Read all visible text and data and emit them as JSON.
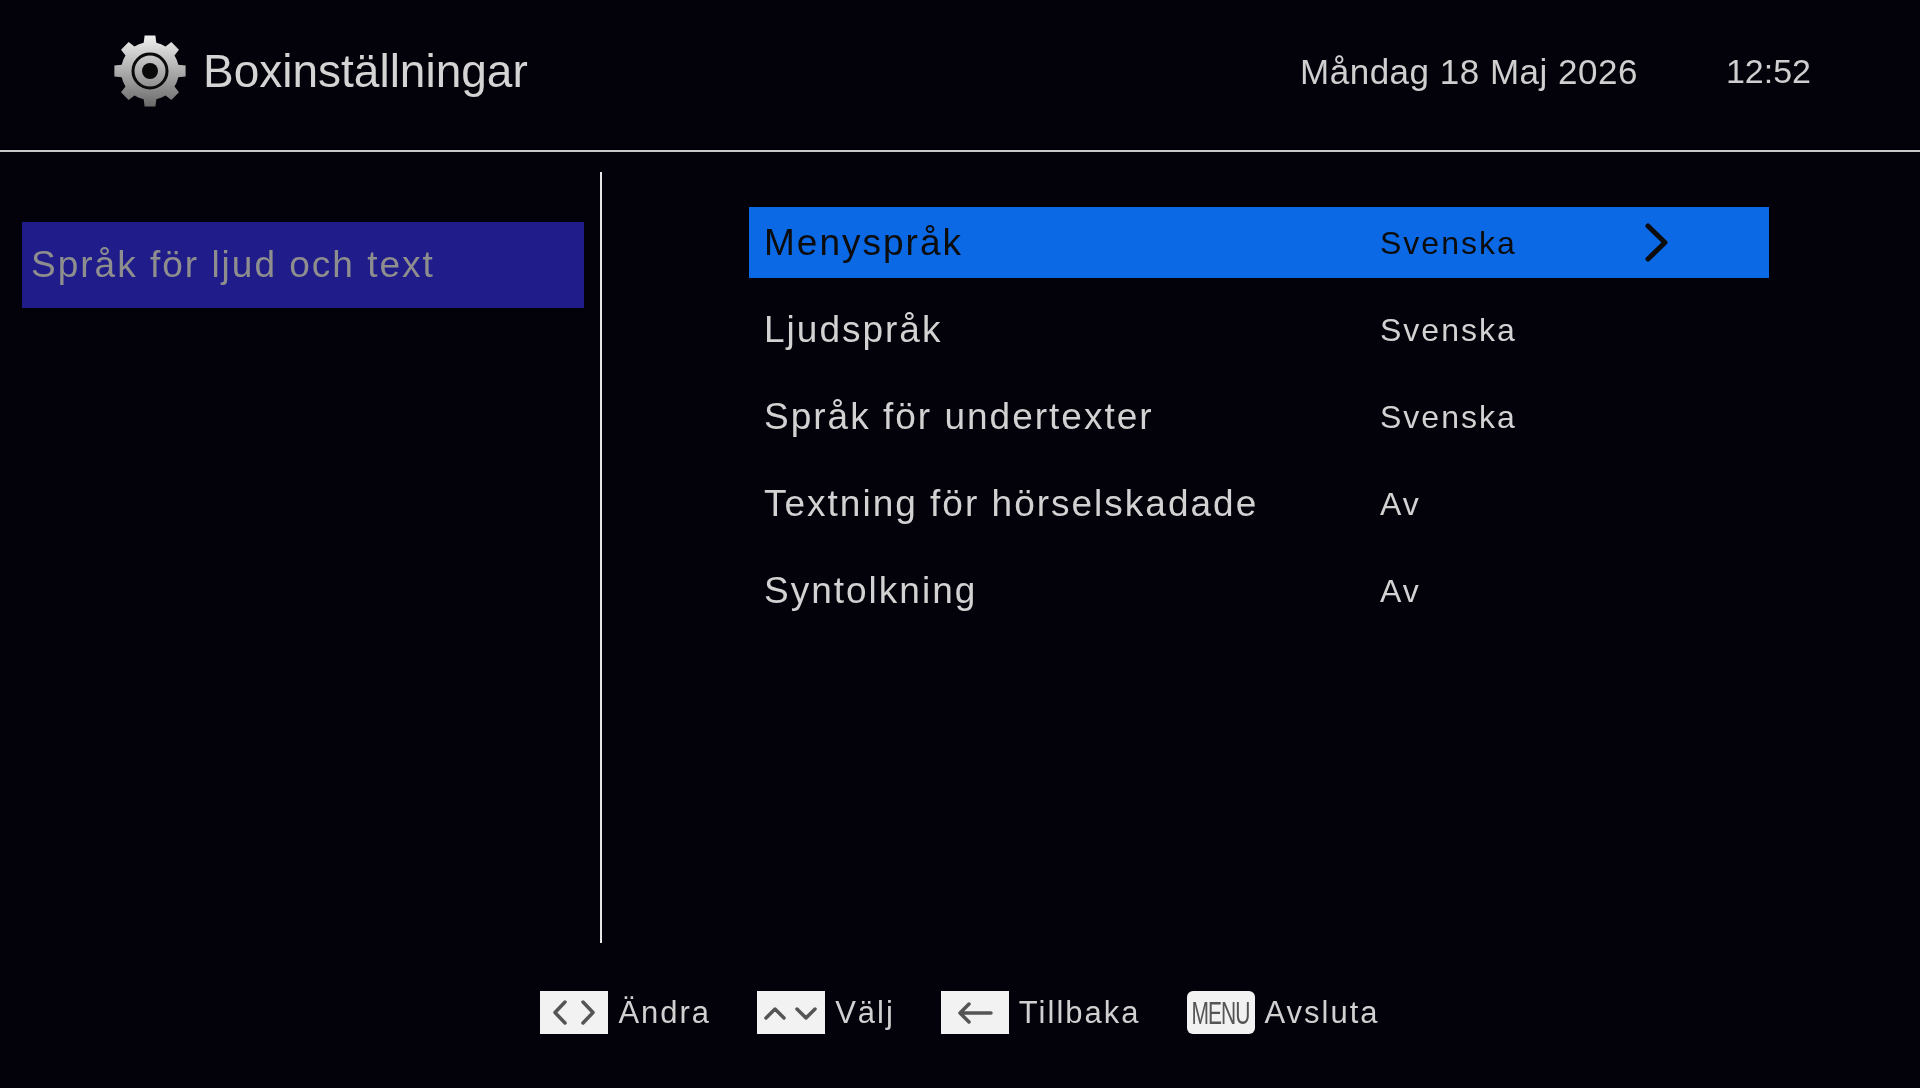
{
  "header": {
    "title": "Boxinställningar",
    "date": "Måndag 18 Maj 2026",
    "time": "12:52"
  },
  "sidebar": {
    "items": [
      {
        "label": "Språk för ljud och text",
        "selected": true
      }
    ]
  },
  "settings": [
    {
      "label": "Menyspråk",
      "value": "Svenska",
      "selected": true
    },
    {
      "label": "Ljudspråk",
      "value": "Svenska",
      "selected": false
    },
    {
      "label": "Språk för undertexter",
      "value": "Svenska",
      "selected": false
    },
    {
      "label": "Textning för hörselskadade",
      "value": "Av",
      "selected": false
    },
    {
      "label": "Syntolkning",
      "value": "Av",
      "selected": false
    }
  ],
  "footer": {
    "hints": [
      {
        "kind": "left_right",
        "label": "Ändra"
      },
      {
        "kind": "up_down",
        "label": "Välj"
      },
      {
        "kind": "back",
        "label": "Tillbaka"
      },
      {
        "kind": "menu",
        "key": "MENU",
        "label": "Avsluta"
      }
    ]
  }
}
